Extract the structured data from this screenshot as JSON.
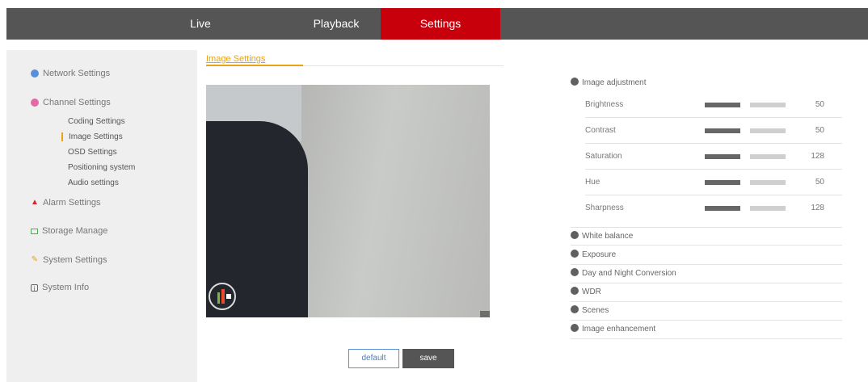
{
  "nav": {
    "tabs": [
      {
        "label": "Live"
      },
      {
        "label": "Playback"
      },
      {
        "label": "Settings",
        "active": true
      }
    ],
    "active_color": "#c8000c"
  },
  "sidebar": {
    "items": [
      {
        "label": "Network Settings",
        "icon": "network-icon"
      },
      {
        "label": "Channel Settings",
        "icon": "channel-icon"
      },
      {
        "label": "Alarm Settings",
        "icon": "alarm-icon"
      },
      {
        "label": "Storage Manage",
        "icon": "storage-icon"
      },
      {
        "label": "System Settings",
        "icon": "system-icon"
      },
      {
        "label": "System Info",
        "icon": "info-icon"
      }
    ],
    "channel_sub": [
      {
        "label": "Coding Settings"
      },
      {
        "label": "Image Settings",
        "active": true
      },
      {
        "label": "OSD Settings"
      },
      {
        "label": "Positioning system"
      },
      {
        "label": "Audio settings"
      }
    ]
  },
  "main": {
    "title": "Image Settings",
    "buttons": {
      "default_label": "default",
      "save_label": "save"
    }
  },
  "image_adjustment": {
    "title": "Image adjustment",
    "rows": [
      {
        "label": "Brightness",
        "value": "50"
      },
      {
        "label": "Contrast",
        "value": "50"
      },
      {
        "label": "Saturation",
        "value": "128"
      },
      {
        "label": "Hue",
        "value": "50"
      },
      {
        "label": "Sharpness",
        "value": "128"
      }
    ]
  },
  "sections": [
    {
      "label": "White balance"
    },
    {
      "label": "Exposure"
    },
    {
      "label": "Day and Night Conversion"
    },
    {
      "label": "WDR"
    },
    {
      "label": "Scenes"
    },
    {
      "label": "Image enhancement"
    }
  ],
  "accent_color": "#e8a317"
}
